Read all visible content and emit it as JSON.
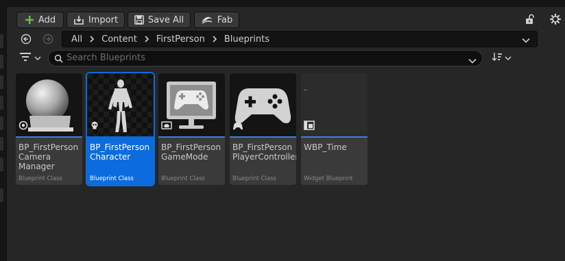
{
  "toolbar": {
    "add_label": "Add",
    "import_label": "Import",
    "save_all_label": "Save All",
    "fab_label": "Fab"
  },
  "breadcrumb": {
    "items": [
      "All",
      "Content",
      "FirstPerson",
      "Blueprints"
    ]
  },
  "search": {
    "placeholder": "Search Blueprints"
  },
  "assets": [
    {
      "name": "BP_FirstPerson Camera Manager",
      "class": "Blueprint Class"
    },
    {
      "name": "BP_FirstPerson Character",
      "class": "Blueprint Class"
    },
    {
      "name": "BP_FirstPerson GameMode",
      "class": "Blueprint Class"
    },
    {
      "name": "BP_FirstPerson PlayerController",
      "class": "Blueprint Class"
    },
    {
      "name": "WBP_Time",
      "class": "Widget Blueprint"
    }
  ],
  "colors": {
    "accent": "#0c6cdd",
    "add_green": "#6cc04a",
    "panel": "#262626"
  }
}
